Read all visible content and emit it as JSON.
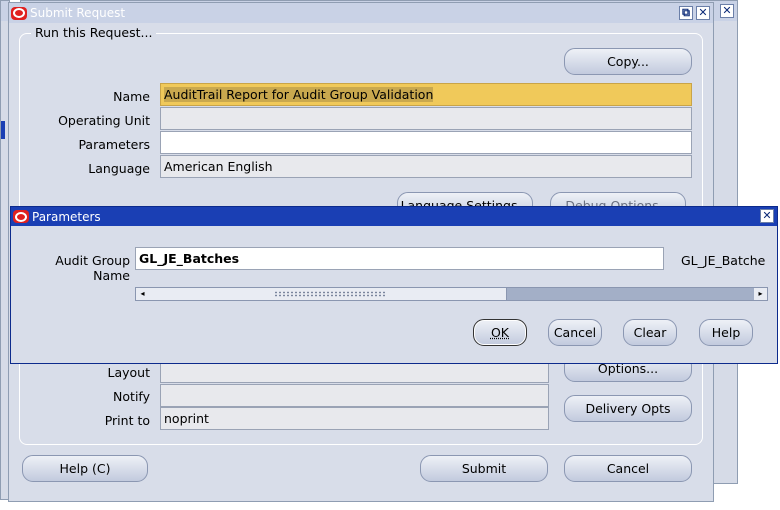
{
  "submit_window": {
    "title": "Submit Request",
    "group_title": "Run this Request...",
    "copy_label": "Copy...",
    "name_label": "Name",
    "name_value": "AuditTrail Report for Audit Group Validation",
    "operating_unit_label": "Operating Unit",
    "operating_unit_value": "",
    "parameters_label": "Parameters",
    "parameters_value": "",
    "language_label": "Language",
    "language_value": "American English",
    "language_settings_label": "Language Settings...",
    "debug_options_label": "Debug Options...",
    "layout_label": "Layout",
    "layout_value": "",
    "notify_label": "Notify",
    "notify_value": "",
    "print_to_label": "Print to",
    "print_to_value": "noprint",
    "options_label": "Options...",
    "delivery_opts_label": "Delivery Opts",
    "help_label": "Help (C)",
    "submit_label": "Submit",
    "cancel_label": "Cancel"
  },
  "parameters_dialog": {
    "title": "Parameters",
    "audit_group_label": "Audit Group Name",
    "audit_group_value": "GL_JE_Batches",
    "description_value": "GL_JE_Batche",
    "ok_label": "OK",
    "cancel_label": "Cancel",
    "clear_label": "Clear",
    "help_label": "Help"
  },
  "colors": {
    "title_active": "#1a3fb4",
    "title_inactive": "#c9d2e6",
    "highlight_field": "#f0c95a",
    "window_bg": "#d8dde9"
  }
}
